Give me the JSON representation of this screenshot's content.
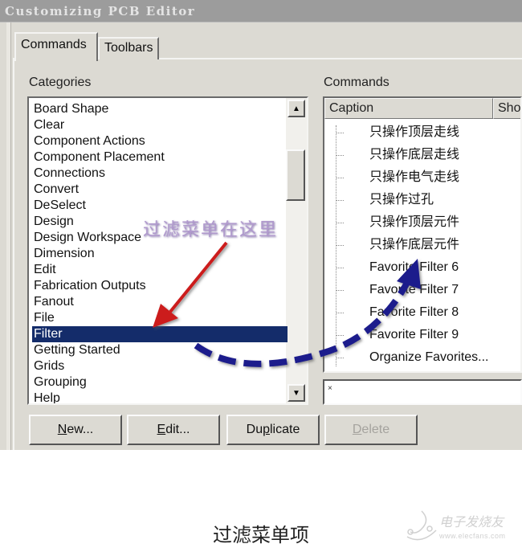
{
  "window": {
    "title": "Customizing PCB Editor"
  },
  "tabs": [
    {
      "label": "Commands",
      "active": true
    },
    {
      "label": "Toolbars",
      "active": false
    }
  ],
  "categories": {
    "label": "Categories",
    "items": [
      "Board Shape",
      "Clear",
      "Component Actions",
      "Component Placement",
      "Connections",
      "Convert",
      "DeSelect",
      "Design",
      "Design Workspace",
      "Dimension",
      "Edit",
      "Fabrication Outputs",
      "Fanout",
      "File",
      "Filter",
      "Getting Started",
      "Grids",
      "Grouping",
      "Help"
    ],
    "selected": "Filter",
    "scroll_up_icon": "triangle-up",
    "scroll_down_icon": "triangle-down"
  },
  "commands": {
    "label": "Commands",
    "columns": [
      "Caption",
      "Sho"
    ],
    "items": [
      "只操作顶层走线",
      "只操作底层走线",
      "只操作电气走线",
      "只操作过孔",
      "只操作顶层元件",
      "只操作底层元件",
      "Favorite Filter 6",
      "Favorite Filter 7",
      "Favorite Filter 8",
      "Favorite Filter 9",
      "Organize Favorites..."
    ]
  },
  "filter_field": {
    "value": "×"
  },
  "buttons": [
    {
      "label": "New...",
      "mnemonic_index": 0,
      "enabled": true
    },
    {
      "label": "Edit...",
      "mnemonic_index": 0,
      "enabled": true
    },
    {
      "label": "Duplicate",
      "mnemonic_index": 2,
      "enabled": true
    },
    {
      "label": "Delete",
      "mnemonic_index": 0,
      "enabled": false
    }
  ],
  "annotation": {
    "text": "过滤菜单在这里",
    "red_arrow_color": "#cc1f1f",
    "blue_arrow_color": "#1a1a8c"
  },
  "colors": {
    "selection": "#142c6a",
    "dialog_bg": "#dcdad3",
    "titlebar": "#9c9c9c"
  },
  "caption": "过滤菜单项",
  "watermark": {
    "name": "电子发烧友",
    "url": "www.elecfans.com"
  }
}
